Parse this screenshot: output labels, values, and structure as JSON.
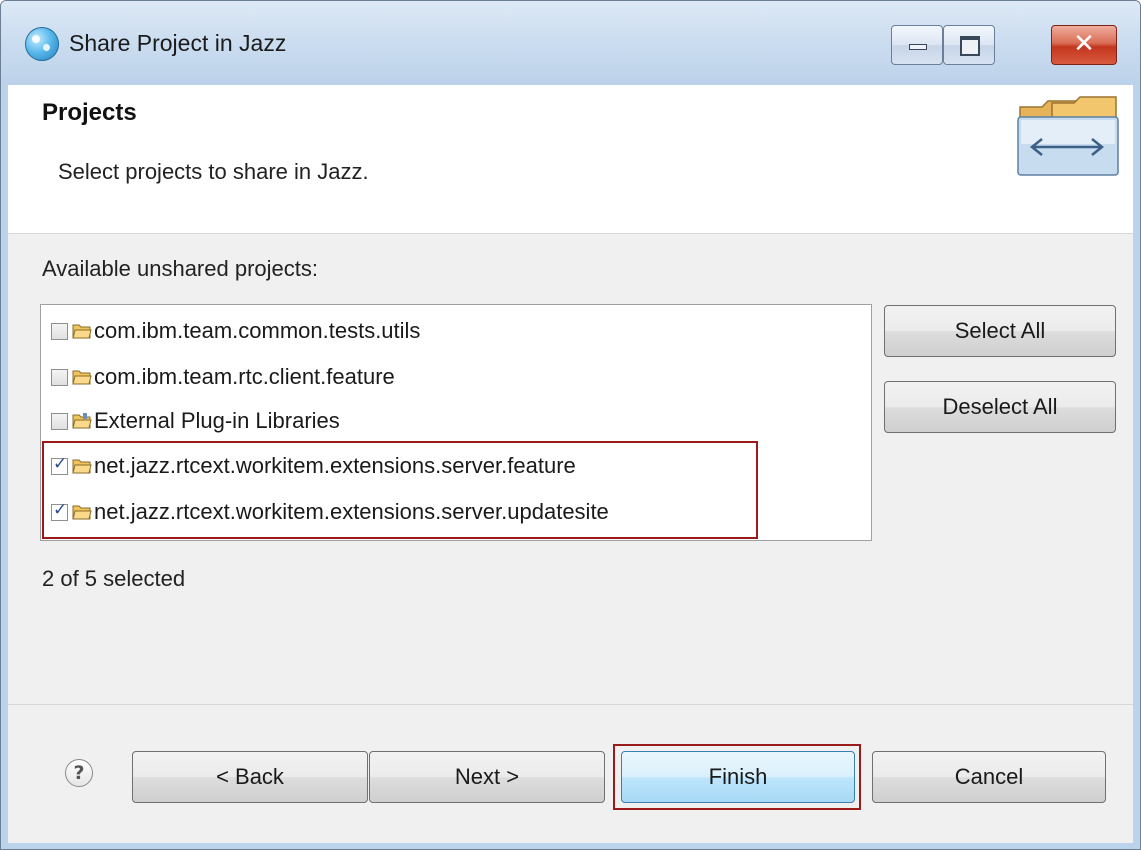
{
  "window": {
    "title": "Share Project in Jazz",
    "close_glyph": "✕",
    "icons": {
      "app": "jazz-app-icon",
      "minimize": "minimize-icon",
      "maximize": "maximize-icon",
      "close": "close-icon"
    }
  },
  "header": {
    "title": "Projects",
    "description": "Select projects to share in Jazz.",
    "icon": "share-folders-icon"
  },
  "list": {
    "label": "Available unshared projects:",
    "items": [
      {
        "label": "com.ibm.team.common.tests.utils",
        "checked": false
      },
      {
        "label": "com.ibm.team.rtc.client.feature",
        "checked": false
      },
      {
        "label": "External Plug-in Libraries",
        "checked": false
      },
      {
        "label": "net.jazz.rtcext.workitem.extensions.server.feature",
        "checked": true
      },
      {
        "label": "net.jazz.rtcext.workitem.extensions.server.updatesite",
        "checked": true
      }
    ]
  },
  "buttons": {
    "select_all": "Select All",
    "deselect_all": "Deselect All",
    "back": "< Back",
    "next": "Next >",
    "finish": "Finish",
    "cancel": "Cancel"
  },
  "status": "2 of 5 selected",
  "help": {
    "glyph": "?"
  },
  "colors": {
    "highlight": "#9b1b1b",
    "titlebar": "#c9dbef",
    "dialog_bg": "#f0f0f0"
  }
}
